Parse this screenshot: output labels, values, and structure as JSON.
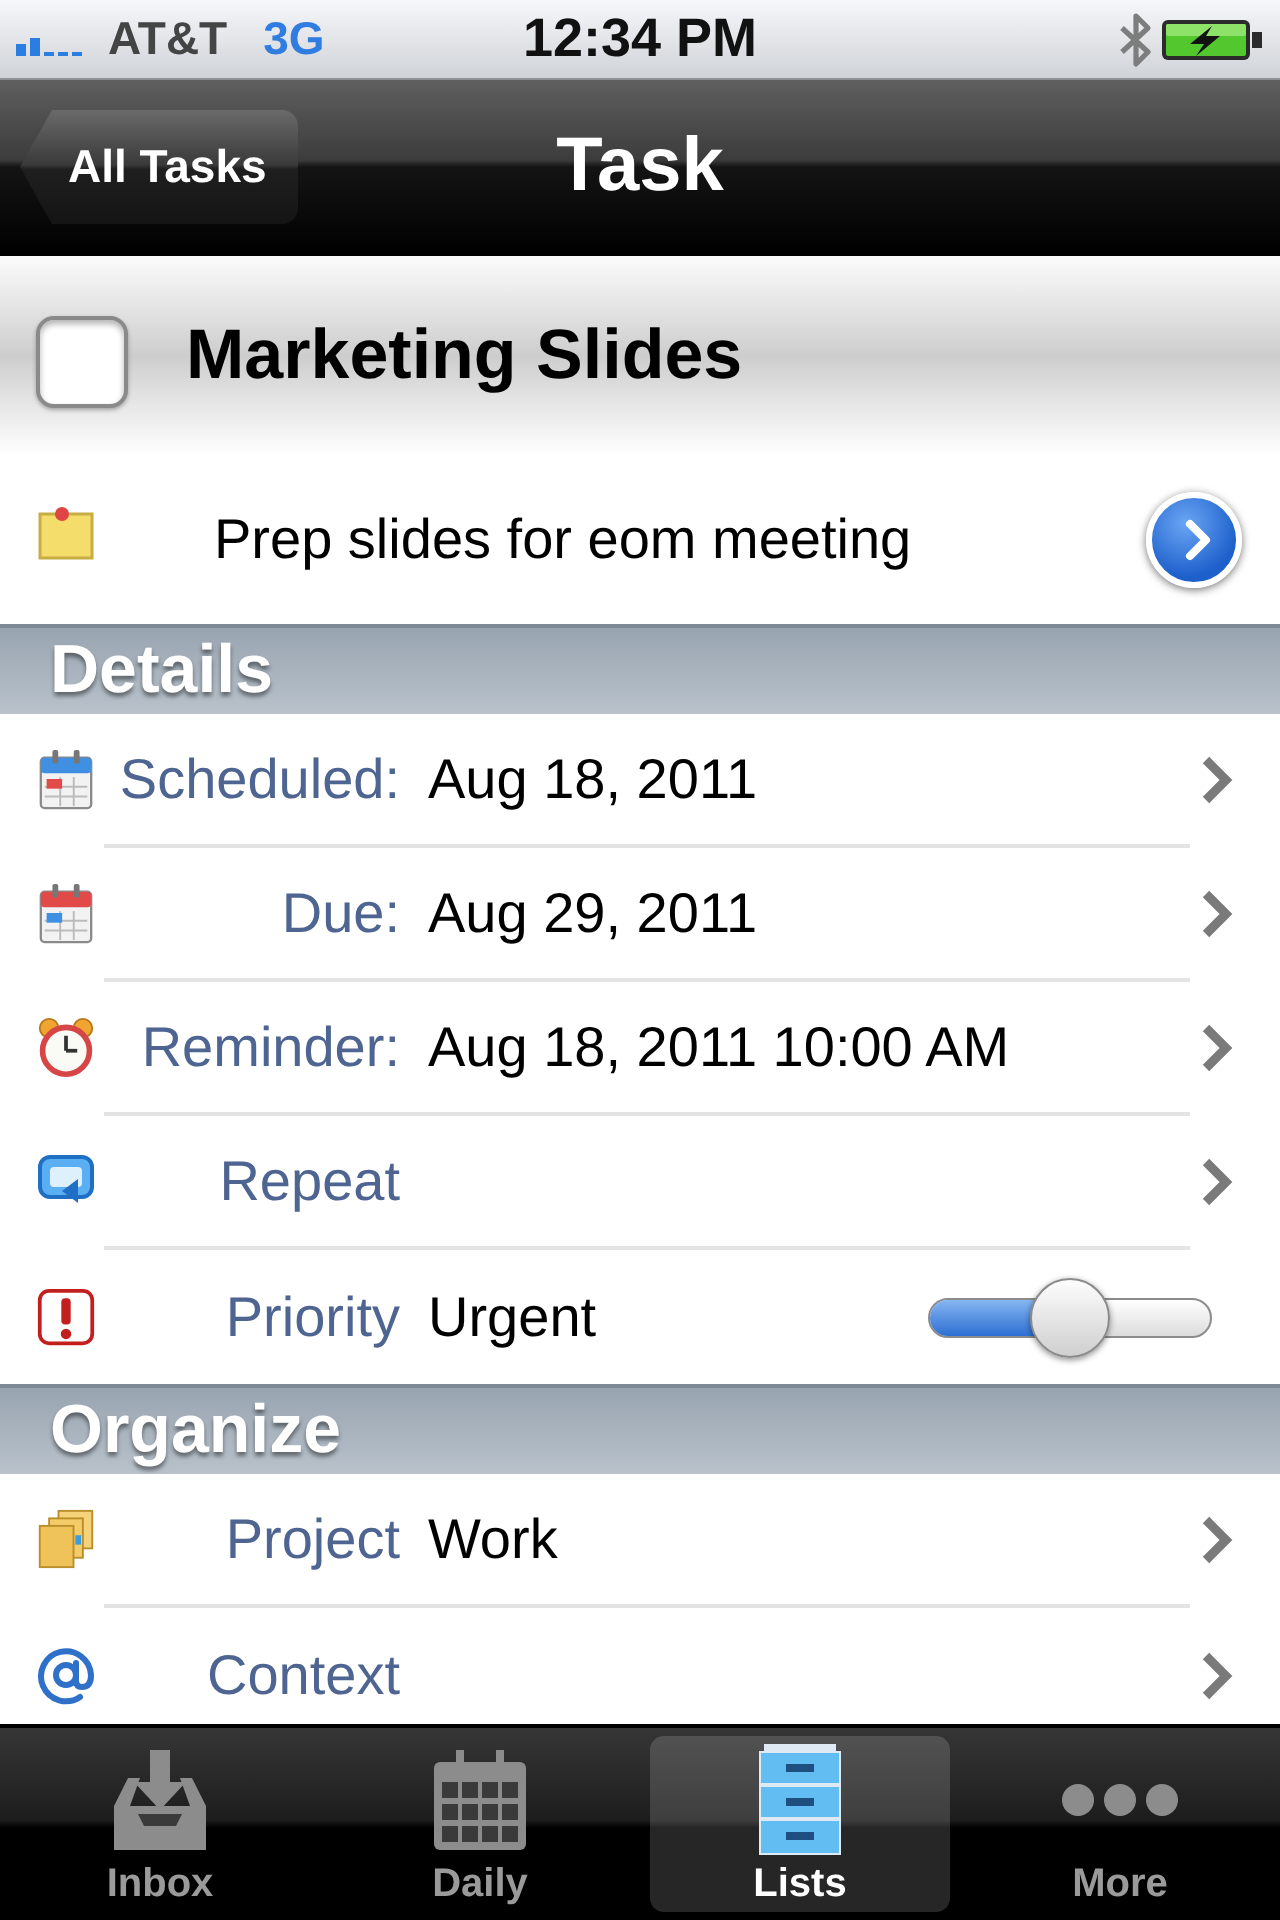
{
  "status_bar": {
    "carrier": "AT&T",
    "network": "3G",
    "time": "12:34 PM"
  },
  "nav_bar": {
    "back_button": "All Tasks",
    "title": "Task"
  },
  "task": {
    "title": "Marketing Slides",
    "completed": false,
    "note": "Prep slides for eom meeting"
  },
  "sections": [
    {
      "title": "Details",
      "rows": [
        {
          "kind": "link",
          "label": "Scheduled:",
          "value": "Aug 18, 2011"
        },
        {
          "kind": "link",
          "label": "Due:",
          "value": "Aug 29, 2011"
        },
        {
          "kind": "link",
          "label": "Reminder:",
          "value": "Aug 18, 2011 10:00 AM"
        },
        {
          "kind": "link",
          "label": "Repeat"
        },
        {
          "kind": "slider",
          "label": "Priority",
          "value": "Urgent",
          "level": 0.5
        }
      ]
    },
    {
      "title": "Organize",
      "rows": [
        {
          "kind": "link",
          "label": "Project",
          "value": "Work"
        },
        {
          "kind": "link",
          "label": "Context"
        }
      ]
    }
  ],
  "tab_bar": [
    {
      "label": "Inbox",
      "selected": false
    },
    {
      "label": "Daily",
      "selected": false
    },
    {
      "label": "Lists",
      "selected": true
    },
    {
      "label": "More",
      "selected": false
    }
  ]
}
